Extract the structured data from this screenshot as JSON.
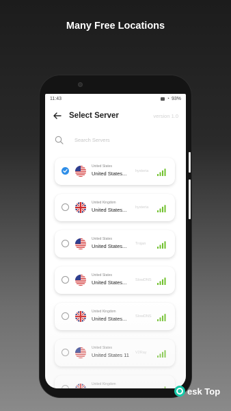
{
  "headline": "Many Free Locations",
  "status": {
    "time": "11:43",
    "battery": "93%"
  },
  "header": {
    "title": "Select Server",
    "version": "version 1.0"
  },
  "search": {
    "placeholder": "Search Servers"
  },
  "servers": [
    {
      "country": "United States",
      "name": "United States...",
      "protocol": "hysteria",
      "flag": "us",
      "selected": true,
      "signal_bars": 4
    },
    {
      "country": "United Kingdom",
      "name": "United States...",
      "protocol": "hysteria",
      "flag": "uk",
      "selected": false,
      "signal_bars": 4
    },
    {
      "country": "United States",
      "name": "United States...",
      "protocol": "Trojan",
      "flag": "us",
      "selected": false,
      "signal_bars": 4
    },
    {
      "country": "United States",
      "name": "United States...",
      "protocol": "SlowDNS",
      "flag": "us",
      "selected": false,
      "signal_bars": 4
    },
    {
      "country": "United Kingdom",
      "name": "United States...",
      "protocol": "SlowDNS",
      "flag": "uk",
      "selected": false,
      "signal_bars": 4
    },
    {
      "country": "United States",
      "name": "United States 11",
      "protocol": "V2Ray",
      "flag": "us",
      "selected": false,
      "signal_bars": 4
    },
    {
      "country": "United Kingdom",
      "name": "",
      "protocol": "",
      "flag": "uk",
      "selected": false,
      "signal_bars": 4
    }
  ],
  "colors": {
    "accent": "#2f8ee8",
    "signal": "#6fc02b"
  },
  "watermark": "esk Top"
}
